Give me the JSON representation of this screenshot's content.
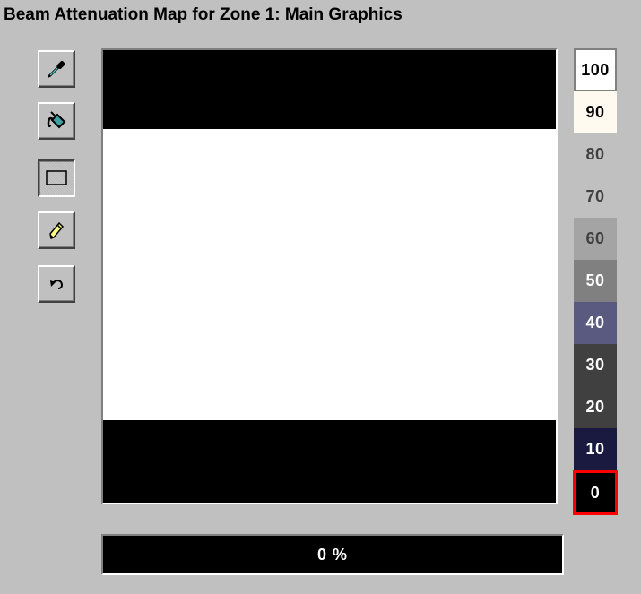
{
  "window": {
    "title": "Beam Attenuation Map for Zone 1: Main Graphics"
  },
  "tools": [
    {
      "icon": "eyedropper-icon",
      "pressed": false
    },
    {
      "icon": "paint-bucket-icon",
      "pressed": false
    },
    {
      "icon": "rectangle-icon",
      "pressed": true
    },
    {
      "icon": "pencil-icon",
      "pressed": false
    },
    {
      "icon": "undo-icon",
      "pressed": false
    }
  ],
  "map": {
    "background_color": "#000000",
    "bands": [
      {
        "value": 0,
        "color": "#000000"
      },
      {
        "value": 100,
        "color": "#ffffff"
      },
      {
        "value": 0,
        "color": "#000000"
      }
    ]
  },
  "palette": {
    "selected_value": "0",
    "swatches": [
      {
        "label": "100",
        "bg": "#ffffff",
        "fg": "#000000"
      },
      {
        "label": "90",
        "bg": "#fffaf0",
        "fg": "#000000"
      },
      {
        "label": "80",
        "bg": "#c0c0c0",
        "fg": "#404040"
      },
      {
        "label": "70",
        "bg": "#c0c0c0",
        "fg": "#404040"
      },
      {
        "label": "60",
        "bg": "#a4a4a4",
        "fg": "#404040"
      },
      {
        "label": "50",
        "bg": "#808080",
        "fg": "#ffffff"
      },
      {
        "label": "40",
        "bg": "#5a5a80",
        "fg": "#ffffff"
      },
      {
        "label": "30",
        "bg": "#404040",
        "fg": "#ffffff"
      },
      {
        "label": "20",
        "bg": "#404040",
        "fg": "#ffffff"
      },
      {
        "label": "10",
        "bg": "#1a1a40",
        "fg": "#ffffff"
      },
      {
        "label": "0",
        "bg": "#000000",
        "fg": "#ffffff"
      }
    ]
  },
  "progress": {
    "text": "0 %",
    "value": 0
  }
}
